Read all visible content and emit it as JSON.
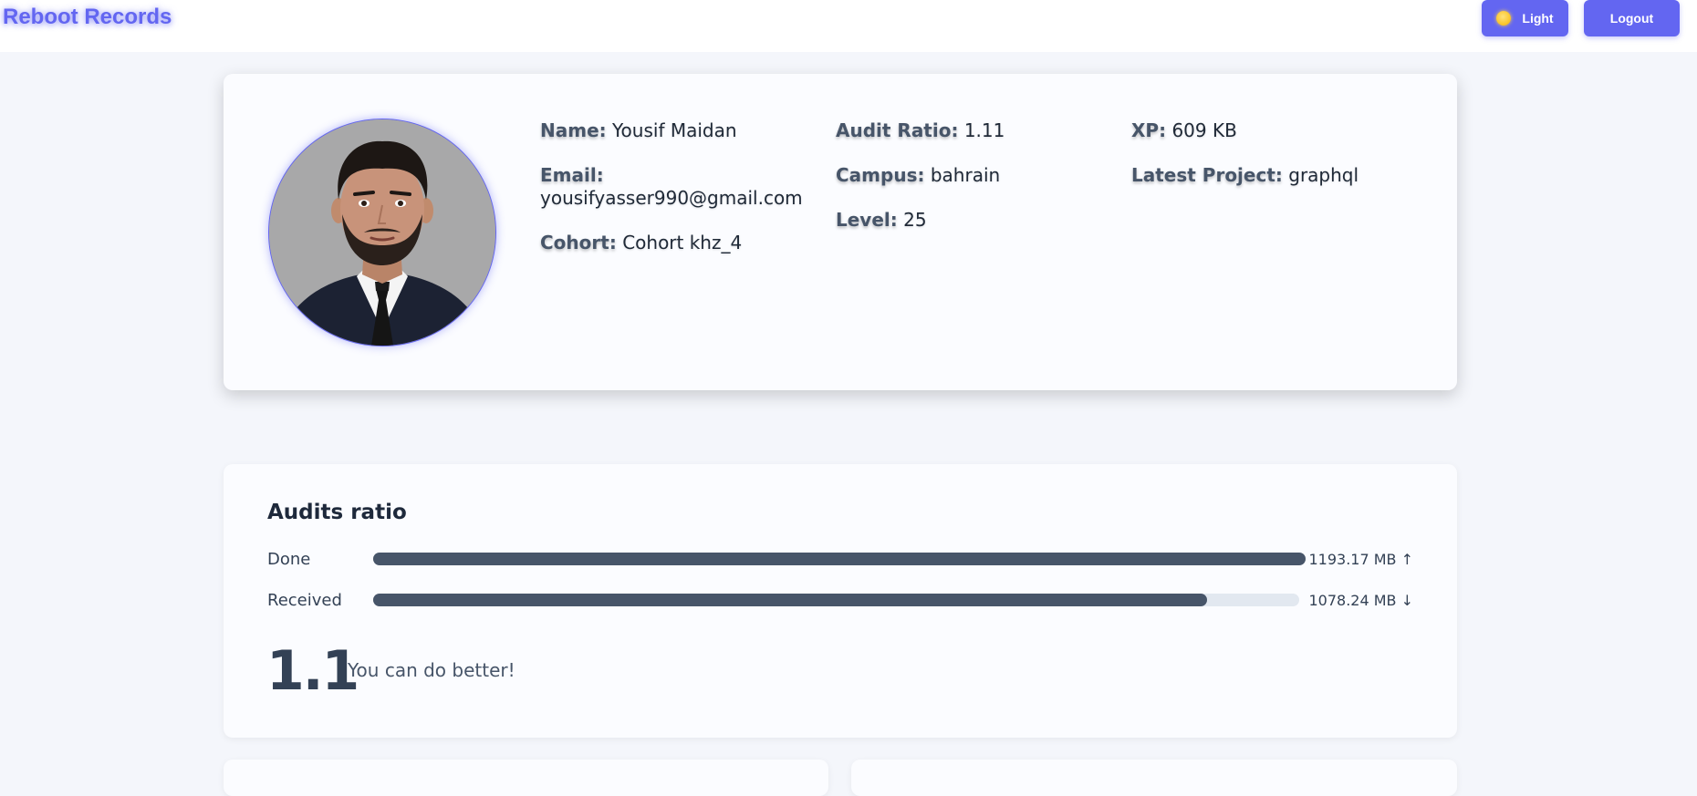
{
  "header": {
    "brand": "Reboot Records",
    "theme_button_label": "Light",
    "theme_icon": "sun-icon",
    "logout_label": "Logout"
  },
  "profile": {
    "name_label": "Name:",
    "name": "Yousif Maidan",
    "email_label": "Email:",
    "email": "yousifyasser990@gmail.com",
    "cohort_label": "Cohort:",
    "cohort": "Cohort khz_4",
    "audit_ratio_label": "Audit Ratio:",
    "audit_ratio": "1.11",
    "campus_label": "Campus:",
    "campus": "bahrain",
    "level_label": "Level:",
    "level": "25",
    "xp_label": "XP:",
    "xp": "609 KB",
    "latest_project_label": "Latest Project:",
    "latest_project": "graphql"
  },
  "audits": {
    "title": "Audits ratio",
    "done_label": "Done",
    "done_value": "1193.17 MB",
    "done_arrow": "↑",
    "done_fraction": 1.0,
    "received_label": "Received",
    "received_value": "1078.24 MB",
    "received_arrow": "↓",
    "received_fraction": 0.9,
    "ratio": "1.1",
    "message": "You can do better!"
  },
  "colors": {
    "accent": "#6366f1",
    "bar_fill": "#475569",
    "bar_track": "#e2e8f0"
  }
}
